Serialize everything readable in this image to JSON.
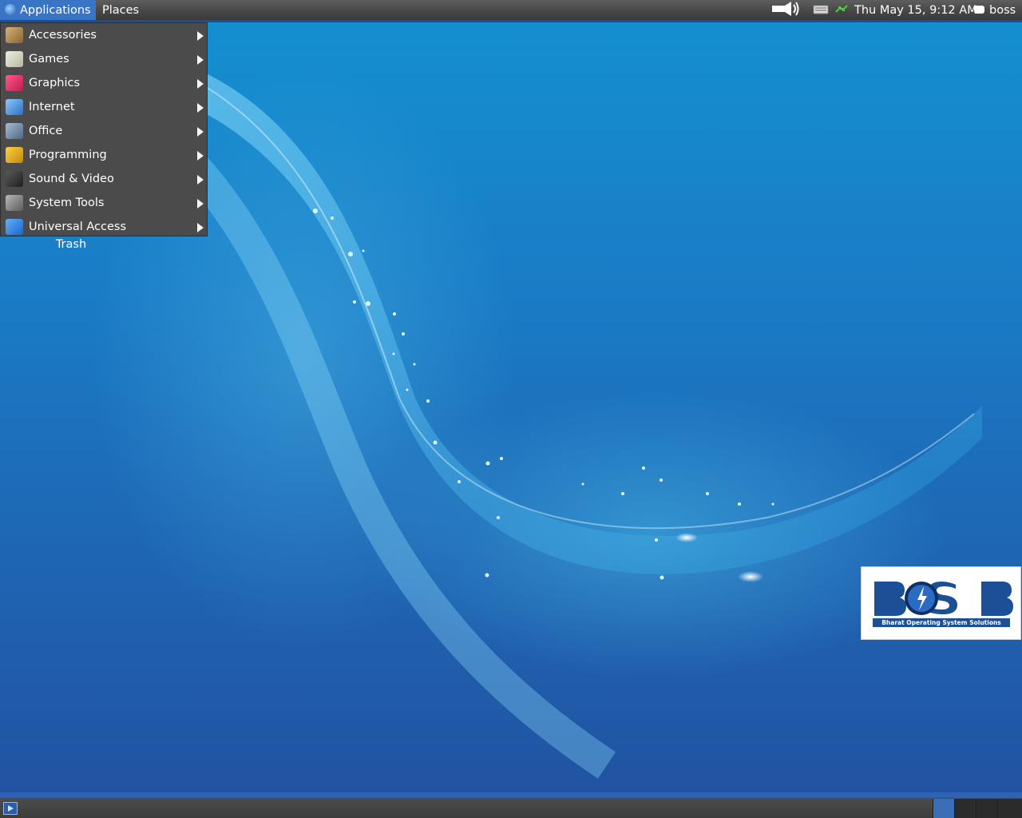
{
  "top_panel": {
    "applications_label": "Applications",
    "places_label": "Places",
    "clock": "Thu May 15,  9:12 AM",
    "user": "boss"
  },
  "app_menu": {
    "items": [
      {
        "label": "Accessories",
        "icon": "accessories-icon",
        "color": "#b9925a"
      },
      {
        "label": "Games",
        "icon": "games-icon",
        "color": "#d8d8c8"
      },
      {
        "label": "Graphics",
        "icon": "graphics-icon",
        "color": "#e0366a"
      },
      {
        "label": "Internet",
        "icon": "internet-icon",
        "color": "#5aa0e6"
      },
      {
        "label": "Office",
        "icon": "office-icon",
        "color": "#7a8fa8"
      },
      {
        "label": "Programming",
        "icon": "programming-icon",
        "color": "#e8b320"
      },
      {
        "label": "Sound & Video",
        "icon": "sound-video-icon",
        "color": "#3c3c3c"
      },
      {
        "label": "System Tools",
        "icon": "system-tools-icon",
        "color": "#8c8c8c"
      },
      {
        "label": "Universal Access",
        "icon": "universal-access-icon",
        "color": "#2f86e0"
      }
    ]
  },
  "desktop": {
    "trash_label": "Trash"
  },
  "boss_logo": {
    "tagline": "Bharat Operating System Solutions"
  },
  "colors": {
    "panel_accent": "#1b4f96",
    "menu_active": "#3a74c4",
    "menu_bg": "#4b4b4b"
  }
}
